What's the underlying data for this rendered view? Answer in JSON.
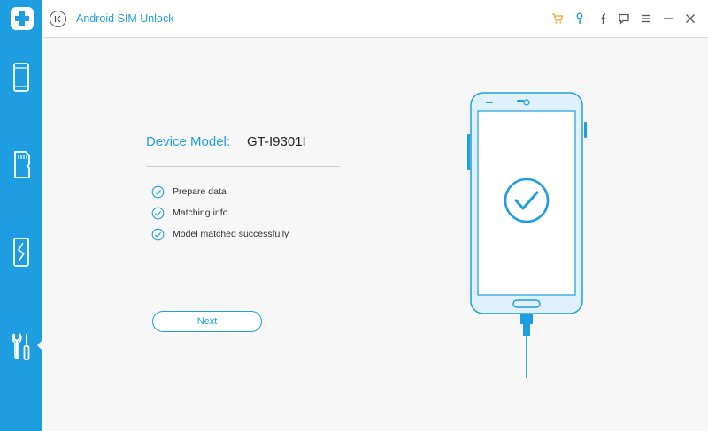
{
  "app": {
    "title": "Android SIM Unlock"
  },
  "sidebar": {
    "items": [
      {
        "name": "phone",
        "icon": "phone-icon"
      },
      {
        "name": "sd-card",
        "icon": "sd-card-icon"
      },
      {
        "name": "broken-phone",
        "icon": "broken-phone-icon"
      },
      {
        "name": "tools",
        "icon": "wrench-screwdriver-icon",
        "active": true
      }
    ]
  },
  "titlebar": {
    "icons": [
      "cart-icon",
      "key-icon",
      "facebook-icon",
      "feedback-icon",
      "menu-icon",
      "minimize-icon",
      "close-icon"
    ],
    "accent_color": "#f5a623"
  },
  "main": {
    "device_label": "Device Model:",
    "device_value": "GT-I9301I",
    "steps": [
      {
        "label": "Prepare data",
        "status": "done"
      },
      {
        "label": "Matching info",
        "status": "done"
      },
      {
        "label": "Model matched successfully",
        "status": "done"
      }
    ],
    "next_label": "Next"
  },
  "colors": {
    "accent": "#1e9ee0",
    "phone_fill": "#dff1fc"
  }
}
